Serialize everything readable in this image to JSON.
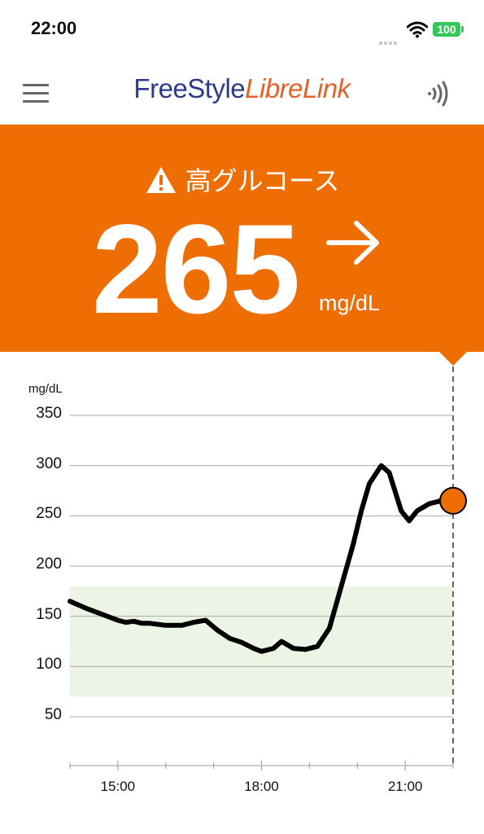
{
  "status_bar": {
    "time": "22:00",
    "battery": "100"
  },
  "header": {
    "brand_primary": "FreeStyle",
    "brand_secondary": "LibreLink",
    "menu_icon": "hamburger-menu-icon",
    "scan_icon": "nfc-scan-icon"
  },
  "alert": {
    "icon": "warning-triangle-icon",
    "label": "高グルコース",
    "value": "265",
    "unit": "mg/dL",
    "trend": "steady-right-arrow"
  },
  "colors": {
    "accent": "#ee6e04",
    "target_range": "#ecf5e5",
    "line": "#000000",
    "brand_blue": "#2c3a8c",
    "brand_orange": "#e4622a"
  },
  "chart_data": {
    "type": "line",
    "ylabel": "mg/dL",
    "ylim": [
      0,
      350
    ],
    "yticks": [
      350,
      300,
      250,
      200,
      150,
      100,
      50
    ],
    "x_labels": [
      "15:00",
      "18:00",
      "21:00"
    ],
    "xlim": [
      "14:00",
      "22:00"
    ],
    "target_range": [
      70,
      180
    ],
    "series": [
      {
        "x": [
          "14:00",
          "14:20",
          "14:40",
          "15:00",
          "15:10",
          "15:20",
          "15:30",
          "15:40",
          "16:00",
          "16:20",
          "16:35",
          "16:50",
          "17:05",
          "17:20",
          "17:35",
          "17:50",
          "18:00",
          "18:15",
          "18:25",
          "18:40",
          "18:55",
          "19:10",
          "19:25",
          "19:40",
          "19:55",
          "20:05",
          "20:15",
          "20:30",
          "20:40",
          "20:55",
          "21:05",
          "21:15",
          "21:30",
          "21:45"
        ],
        "y": [
          165,
          158,
          152,
          146,
          144,
          145,
          143,
          143,
          141,
          141,
          144,
          146,
          136,
          128,
          124,
          118,
          115,
          118,
          125,
          118,
          117,
          120,
          138,
          180,
          222,
          255,
          282,
          300,
          293,
          255,
          245,
          255,
          262,
          265
        ]
      }
    ],
    "current": {
      "x": "22:00",
      "y": 265
    }
  }
}
